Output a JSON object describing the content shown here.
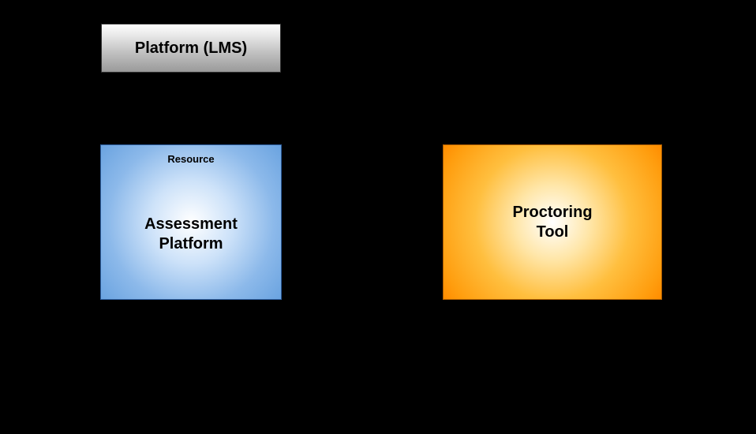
{
  "nodes": {
    "lms": {
      "label": "Platform (LMS)"
    },
    "assessment": {
      "role": "Resource",
      "title_line1": "Assessment",
      "title_line2": "Platform"
    },
    "proctoring": {
      "title_line1": "Proctoring",
      "title_line2": "Tool"
    }
  }
}
